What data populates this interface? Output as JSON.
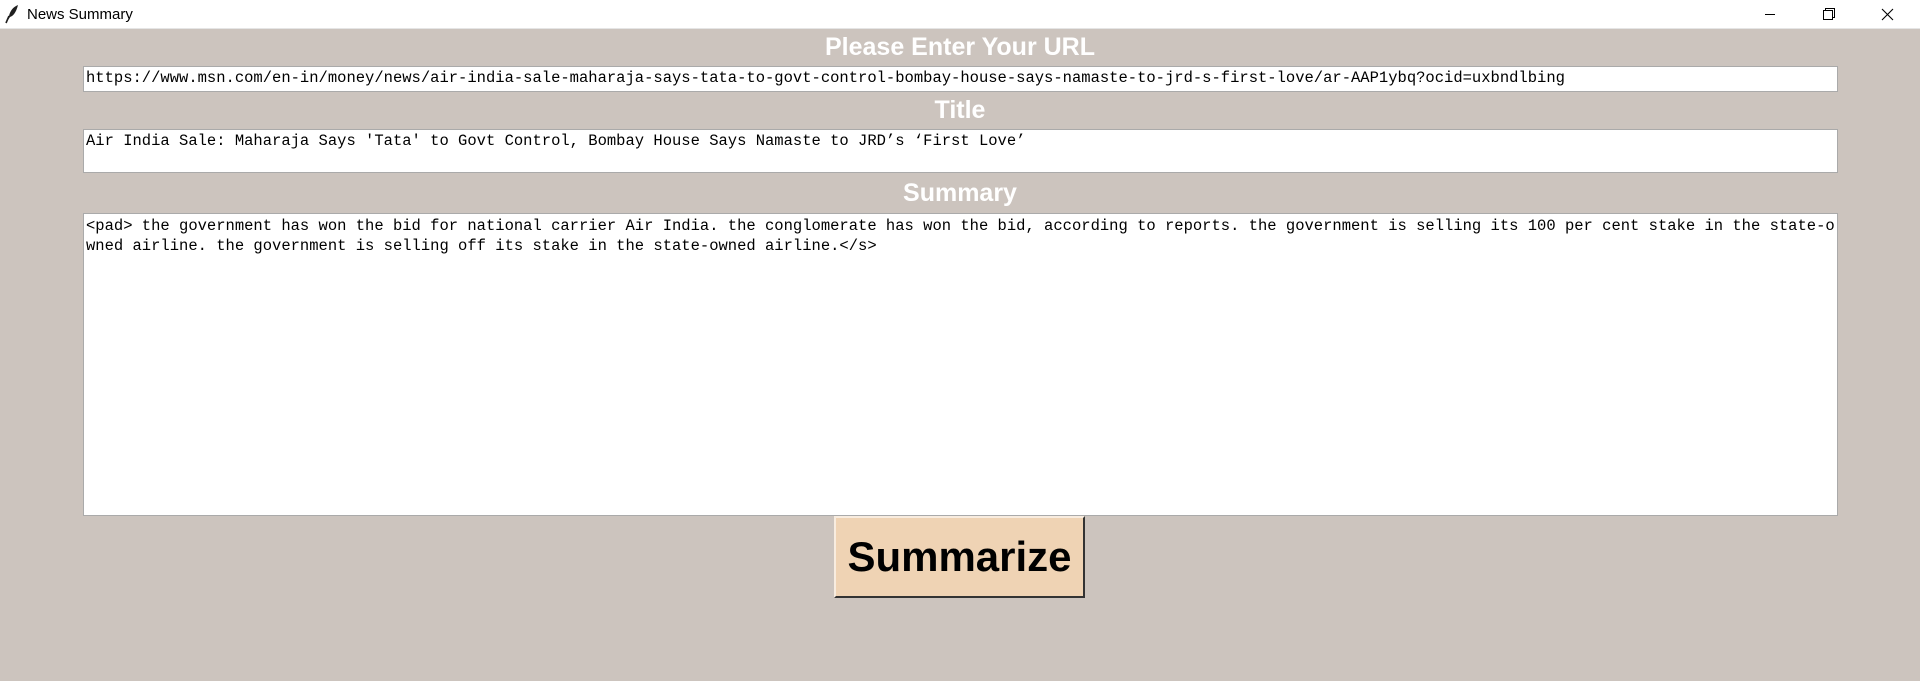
{
  "window": {
    "title": "News Summary",
    "icon": "feather-icon",
    "controls": [
      "minimize-icon",
      "restore-icon",
      "close-icon"
    ]
  },
  "labels": {
    "url": "Please Enter Your URL",
    "title": "Title",
    "summary": "Summary"
  },
  "fields": {
    "url_value": "https://www.msn.com/en-in/money/news/air-india-sale-maharaja-says-tata-to-govt-control-bombay-house-says-namaste-to-jrd-s-first-love/ar-AAP1ybq?ocid=uxbndlbing",
    "title_value": "Air India Sale: Maharaja Says 'Tata' to Govt Control, Bombay House Says Namaste to JRD’s ‘First Love’",
    "summary_value": "<pad> the government has won the bid for national carrier Air India. the conglomerate has won the bid, according to reports. the government is selling its 100 per cent stake in the state-owned airline. the government is selling off its stake in the state-owned airline.</s>"
  },
  "actions": {
    "summarize_label": "Summarize"
  },
  "colors": {
    "background": "#ccc4be",
    "label_text": "#ffffff",
    "button_background": "#efd3b4"
  }
}
